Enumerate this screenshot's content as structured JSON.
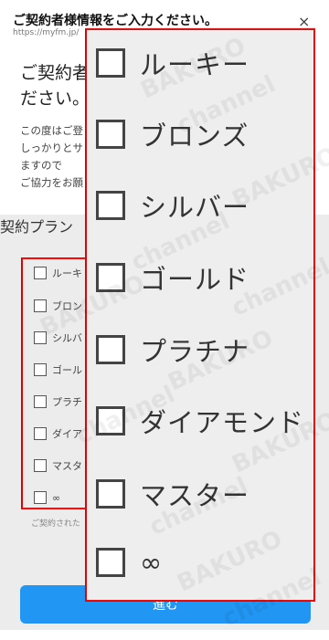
{
  "header": {
    "title": "ご契約者様情報をご入力ください。",
    "url": "https://myfm.jp/",
    "close_glyph": "×"
  },
  "intro": {
    "heading_line1": "ご契約者",
    "heading_line2": "ださい。",
    "desc_line1": "この度はご登",
    "desc_line2": "しっかりとサ",
    "desc_line3": "ますので",
    "desc_line4": "ご協力をお願"
  },
  "form": {
    "plan_label": "契約プラン",
    "note": "ご契約された",
    "submit_label": "進む"
  },
  "plans": [
    {
      "label": "ルーキー",
      "checked": false
    },
    {
      "label": "ブロンズ",
      "checked": false
    },
    {
      "label": "シルバー",
      "checked": false
    },
    {
      "label": "ゴールド",
      "checked": false
    },
    {
      "label": "プラチナ",
      "checked": false
    },
    {
      "label": "ダイアモンド",
      "checked": false
    },
    {
      "label": "マスター",
      "checked": false
    },
    {
      "label": "∞",
      "checked": false
    }
  ],
  "plans_truncated": [
    "ルーキ",
    "ブロン",
    "シルバ",
    "ゴール",
    "プラチ",
    "ダイア",
    "マスタ",
    "∞"
  ],
  "watermark": {
    "brand": "BAKURO",
    "sub": "channel"
  },
  "colors": {
    "highlight_border": "#e10000",
    "submit_bg": "#2196f3",
    "panel_bg": "#ececec"
  }
}
